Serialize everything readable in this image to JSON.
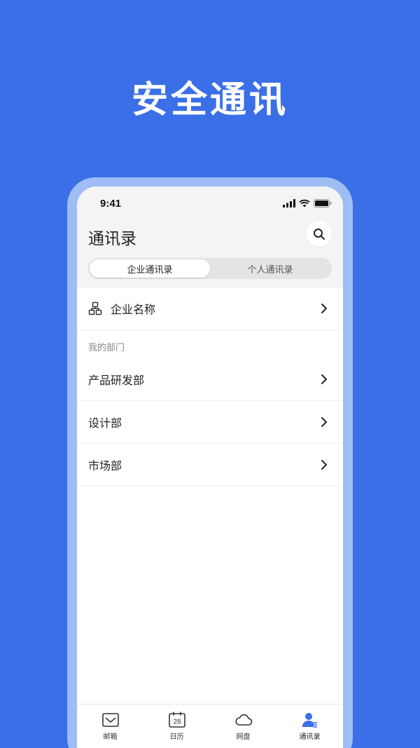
{
  "hero": {
    "title": "安全通讯"
  },
  "status_bar": {
    "time": "9:41"
  },
  "header": {
    "title": "通讯录"
  },
  "segmented": {
    "tabs": [
      {
        "label": "企业通讯录",
        "active": true
      },
      {
        "label": "个人通讯录",
        "active": false
      }
    ]
  },
  "org": {
    "label": "企业名称",
    "icon": "org-chart-icon"
  },
  "section": {
    "label": "我的部门"
  },
  "departments": [
    {
      "label": "产品研发部"
    },
    {
      "label": "设计部"
    },
    {
      "label": "市场部"
    }
  ],
  "tabbar": {
    "items": [
      {
        "label": "邮箱",
        "icon": "mail-icon"
      },
      {
        "label": "日历",
        "icon": "calendar-icon",
        "day": "28"
      },
      {
        "label": "网盘",
        "icon": "cloud-icon"
      },
      {
        "label": "通讯录",
        "icon": "contacts-icon",
        "active": true
      }
    ]
  },
  "colors": {
    "background": "#3A6FE8",
    "frame": "#9FBDF5",
    "accent": "#3A6FE8"
  }
}
